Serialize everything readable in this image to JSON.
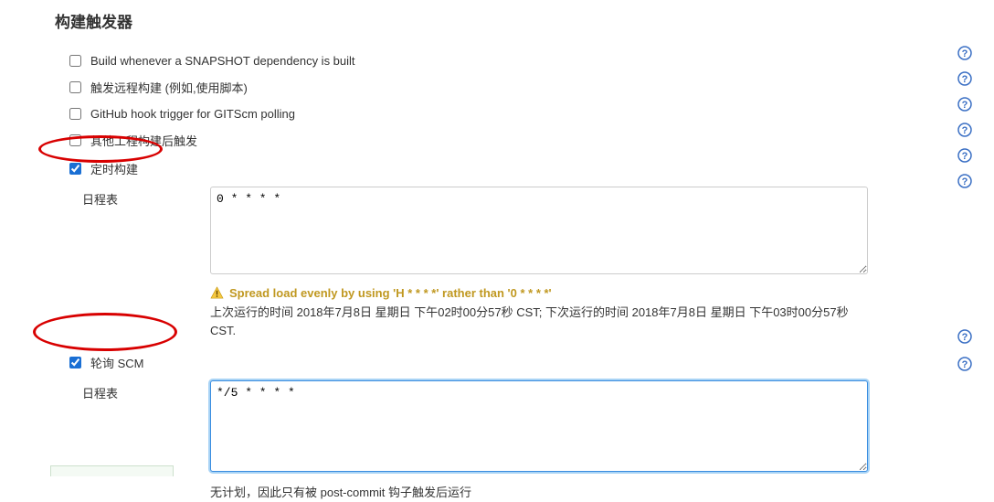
{
  "section_title": "构建触发器",
  "triggers": {
    "snapshot": {
      "label": "Build whenever a SNAPSHOT dependency is built",
      "checked": false
    },
    "remote": {
      "label": "触发远程构建 (例如,使用脚本)",
      "checked": false
    },
    "github": {
      "label": "GitHub hook trigger for GITScm polling",
      "checked": false
    },
    "upstream": {
      "label": "其他工程构建后触发",
      "checked": false
    },
    "timer": {
      "label": "定时构建",
      "checked": true
    },
    "scm": {
      "label": "轮询 SCM",
      "checked": true
    }
  },
  "timer_panel": {
    "schedule_label": "日程表",
    "schedule_value": "0 * * * *",
    "warn_text": "Spread load evenly by using 'H *  * *  *' rather than '0 *  *  * *'",
    "info_text": "上次运行的时间 2018年7月8日 星期日 下午02时00分57秒 CST; 下次运行的时间 2018年7月8日 星期日 下午03时00分57秒 CST."
  },
  "scm_panel": {
    "schedule_label": "日程表",
    "schedule_value": "*/5 * * * *",
    "info_text": "无计划，因此只有被 post-commit 钩子触发后运行"
  }
}
